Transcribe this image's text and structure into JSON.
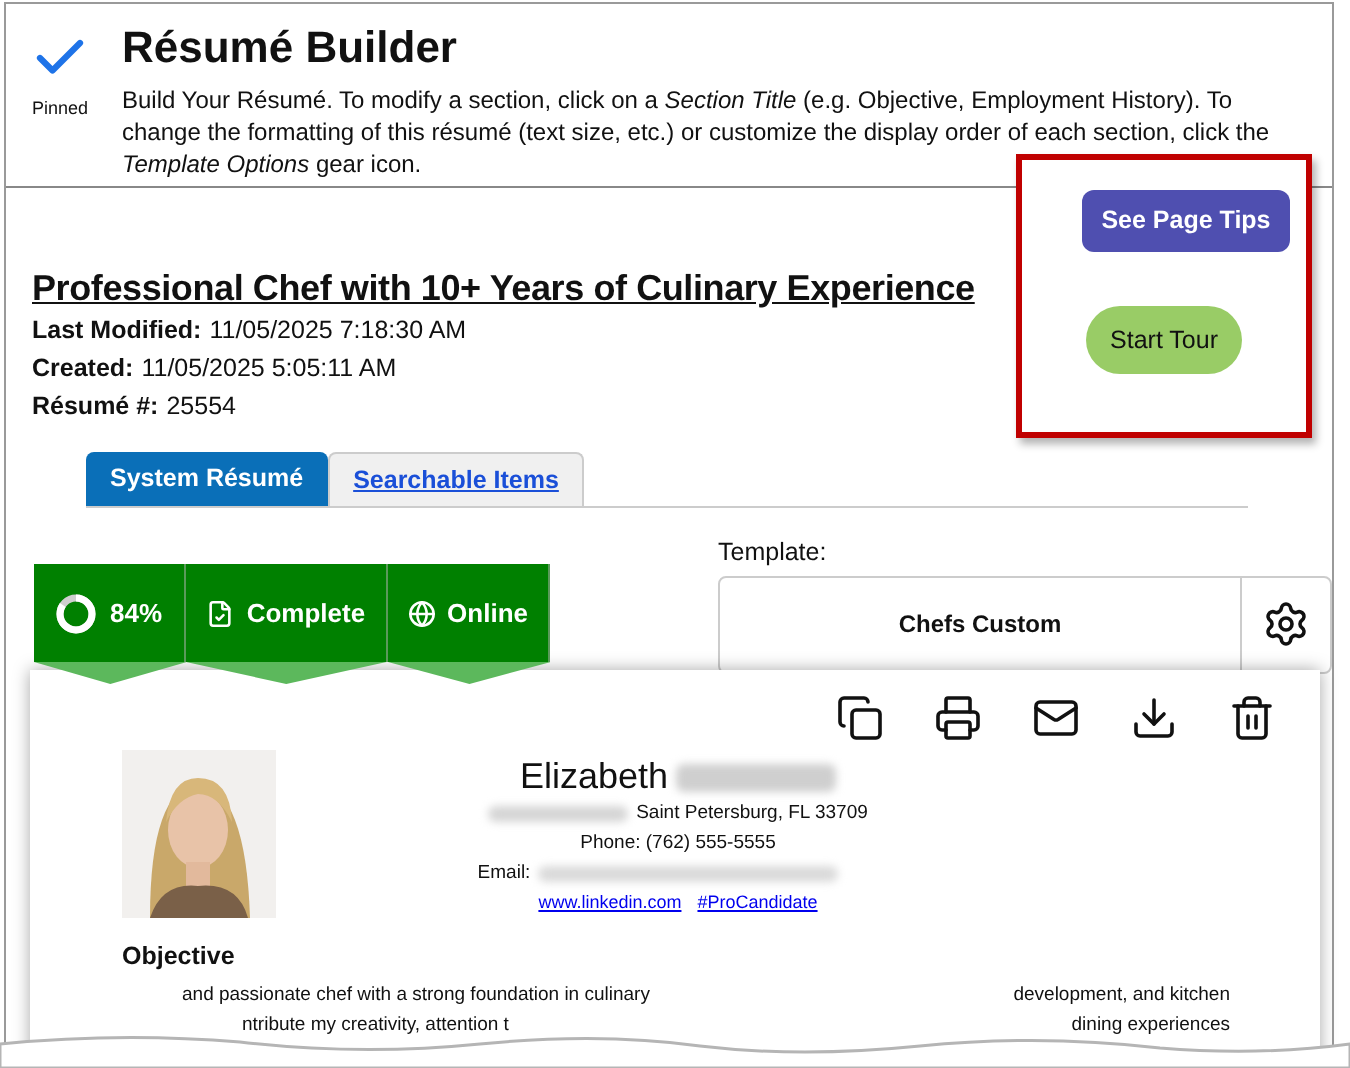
{
  "header": {
    "pinned_label": "Pinned",
    "title": "Résumé Builder",
    "instructions": "Build Your Résumé. To modify a section, click on a *Section Title* (e.g. Objective, Employment History). To change the formatting of this résumé (text size, etc.) or customize the display order of each section, click the *Template Options* gear icon."
  },
  "tips_button": "See Page Tips",
  "tour_button": "Start Tour",
  "resume": {
    "title": "Professional Chef with 10+ Years of Culinary Experience",
    "meta": [
      {
        "label": "Last Modified:",
        "value": "11/05/2025 7:18:30 AM"
      },
      {
        "label": "Created:",
        "value": "11/05/2025 5:05:11 AM"
      },
      {
        "label": "Résumé #:",
        "value": "25554"
      }
    ]
  },
  "tabs": [
    {
      "label": "System Résumé",
      "selected": true
    },
    {
      "label": "Searchable Items",
      "selected": false
    }
  ],
  "badges": [
    {
      "kind": "progress",
      "label": "84%"
    },
    {
      "kind": "complete",
      "label": "Complete"
    },
    {
      "kind": "online",
      "label": "Online"
    }
  ],
  "template": {
    "label": "Template:",
    "value": "Chefs Custom"
  },
  "document": {
    "first_name": "Elizabeth",
    "city_line": "Saint Petersburg, FL 33709",
    "phone": "Phone: (762) 555-5555",
    "email_label": "Email:",
    "links": [
      "www.linkedin.com",
      "#ProCandidate"
    ],
    "section_title": "Objective",
    "fragments": [
      [
        "and passionate chef with a strong foundation in culinary",
        "development, and kitchen"
      ],
      [
        "ntribute my creativity, attention t",
        "dining experiences"
      ]
    ]
  }
}
